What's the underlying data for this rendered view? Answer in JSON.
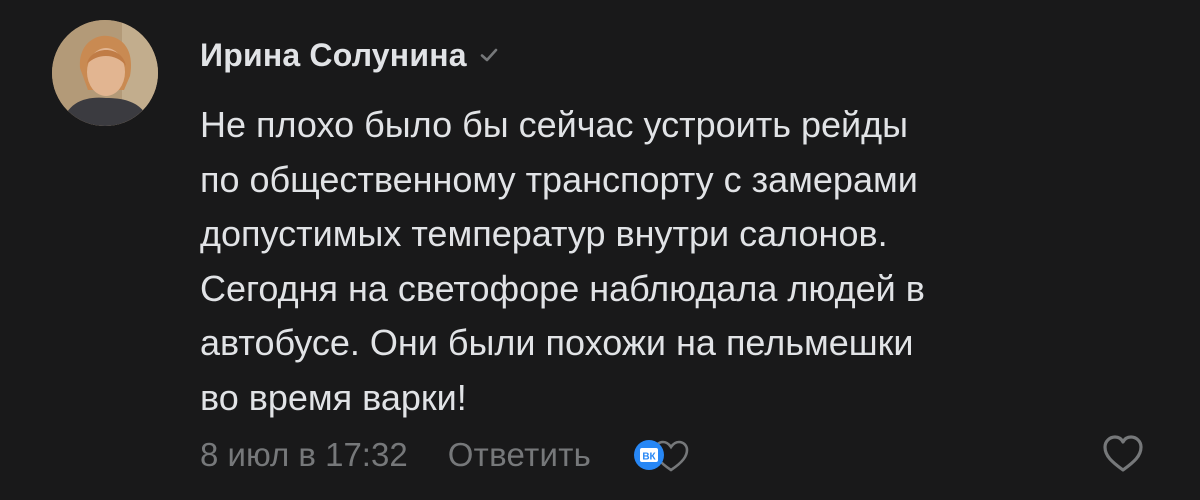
{
  "comment": {
    "author": "Ирина Солунина",
    "verified_icon": "checkmark-icon",
    "text_lines": [
      "Не плохо было бы сейчас устроить рейды",
      "по общественному транспорту с замерами",
      "допустимых температур внутри салонов.",
      "Сегодня на светофоре наблюдала людей в",
      "автобусе. Они были похожи на пельмешки",
      "во время варки!"
    ],
    "date": "8 июл в 17:32",
    "reply_label": "Ответить",
    "reaction_badge": "ВК",
    "reaction_icon": "heart-icon",
    "like_icon": "heart-outline-icon"
  },
  "colors": {
    "background": "#19191a",
    "text": "#e1e3e6",
    "secondary": "#76787a",
    "vk_blue": "#2787f5"
  }
}
